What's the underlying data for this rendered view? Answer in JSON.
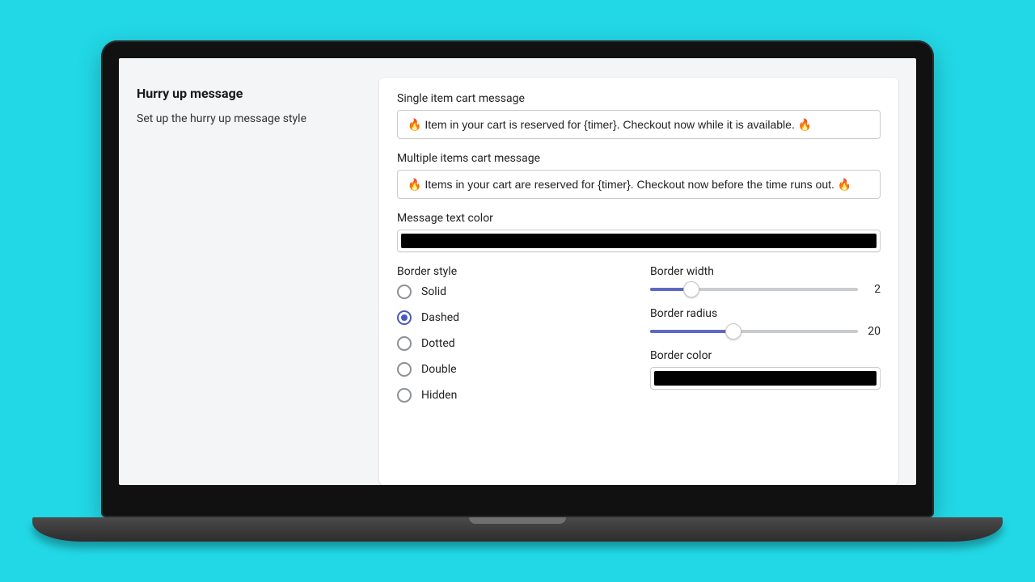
{
  "section": {
    "title": "Hurry up message",
    "description": "Set up the hurry up message style"
  },
  "fields": {
    "single_label": "Single item cart message",
    "single_value": "🔥 Item in your cart is reserved for {timer}. Checkout now while it is available. 🔥",
    "multi_label": "Multiple items cart message",
    "multi_value": "🔥 Items in your cart are reserved for {timer}. Checkout now before the time runs out. 🔥",
    "text_color_label": "Message text color",
    "text_color_value": "#000000"
  },
  "border": {
    "style_label": "Border style",
    "options": {
      "solid": "Solid",
      "dashed": "Dashed",
      "dotted": "Dotted",
      "double": "Double",
      "hidden": "Hidden"
    },
    "selected": "dashed",
    "width_label": "Border width",
    "width_value": "2",
    "width_max": 10,
    "radius_label": "Border radius",
    "radius_value": "20",
    "radius_max": 50,
    "color_label": "Border color",
    "color_value": "#000000"
  }
}
